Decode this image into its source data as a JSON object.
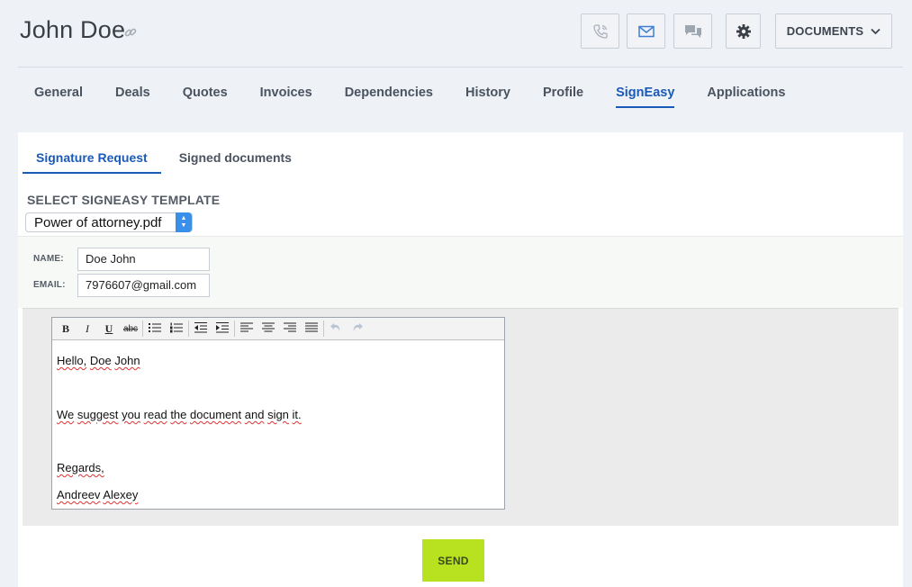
{
  "contact": {
    "name": "John Doe"
  },
  "header_actions": {
    "phone_icon": "phone-icon",
    "email_icon": "envelope-icon",
    "chat_icon": "chat-bubbles-icon",
    "settings_icon": "gear-icon",
    "documents_label": "DOCUMENTS"
  },
  "tabs": [
    {
      "label": "General",
      "active": false
    },
    {
      "label": "Deals",
      "active": false
    },
    {
      "label": "Quotes",
      "active": false
    },
    {
      "label": "Invoices",
      "active": false
    },
    {
      "label": "Dependencies",
      "active": false
    },
    {
      "label": "History",
      "active": false
    },
    {
      "label": "Profile",
      "active": false
    },
    {
      "label": "SignEasy",
      "active": true
    },
    {
      "label": "Applications",
      "active": false
    }
  ],
  "subtabs": [
    {
      "label": "Signature Request",
      "active": true
    },
    {
      "label": "Signed documents",
      "active": false
    }
  ],
  "template": {
    "label": "SELECT SIGNEASY TEMPLATE",
    "selected": "Power of attorney.pdf"
  },
  "form": {
    "name_label": "NAME:",
    "name_value": "Doe John",
    "email_label": "EMAIL:",
    "email_value": "7976607@gmail.com"
  },
  "editor": {
    "toolbar": {
      "bold": "B",
      "italic": "I",
      "underline": "U",
      "strike": "abc"
    },
    "lines": [
      [
        "Hello,",
        "Doe",
        "John"
      ],
      [
        "We",
        "suggest",
        "you",
        "read",
        "the",
        "document",
        "and",
        "sign",
        "it."
      ],
      [
        "Regards,"
      ],
      [
        "Andreev",
        "Alexey"
      ]
    ]
  },
  "send_label": "SEND",
  "colors": {
    "accent": "#1a5ab8",
    "send": "#b8e21f",
    "background": "#eef1f5"
  }
}
